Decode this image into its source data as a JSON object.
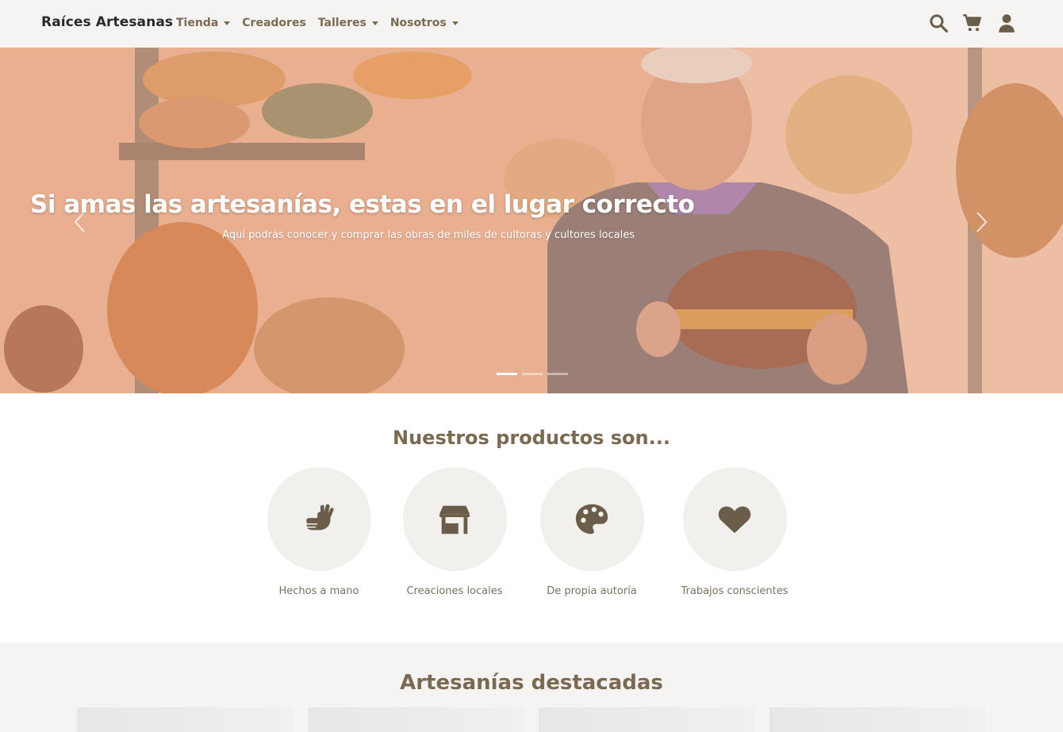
{
  "navbar": {
    "brand": "Raíces Artesanas",
    "links": [
      {
        "label": "Tienda",
        "dropdown": true
      },
      {
        "label": "Creadores",
        "dropdown": false
      },
      {
        "label": "Talleres",
        "dropdown": true
      },
      {
        "label": "Nosotros",
        "dropdown": true
      }
    ],
    "icons": [
      "search-icon",
      "cart-icon",
      "user-icon"
    ]
  },
  "hero": {
    "title": "Si amas las artesanías, estas en el lugar correcto",
    "subtitle": "Aquí podrás conocer y comprar las obras de miles de cultoras y cultores locales",
    "slides": 3,
    "active_slide": 1
  },
  "features": {
    "title": "Nuestros productos son...",
    "items": [
      {
        "label": "Hechos a mano",
        "icon": "hands-icon"
      },
      {
        "label": "Creaciones locales",
        "icon": "store-icon"
      },
      {
        "label": "De propia autoría",
        "icon": "palette-icon"
      },
      {
        "label": "Trabajos conscientes",
        "icon": "heart-icon"
      }
    ]
  },
  "featured": {
    "title": "Artesanías destacadas"
  },
  "colors": {
    "accent": "#7a6a52",
    "navbar_bg": "#f5f4f2",
    "circle_bg": "#f2f0ed"
  }
}
